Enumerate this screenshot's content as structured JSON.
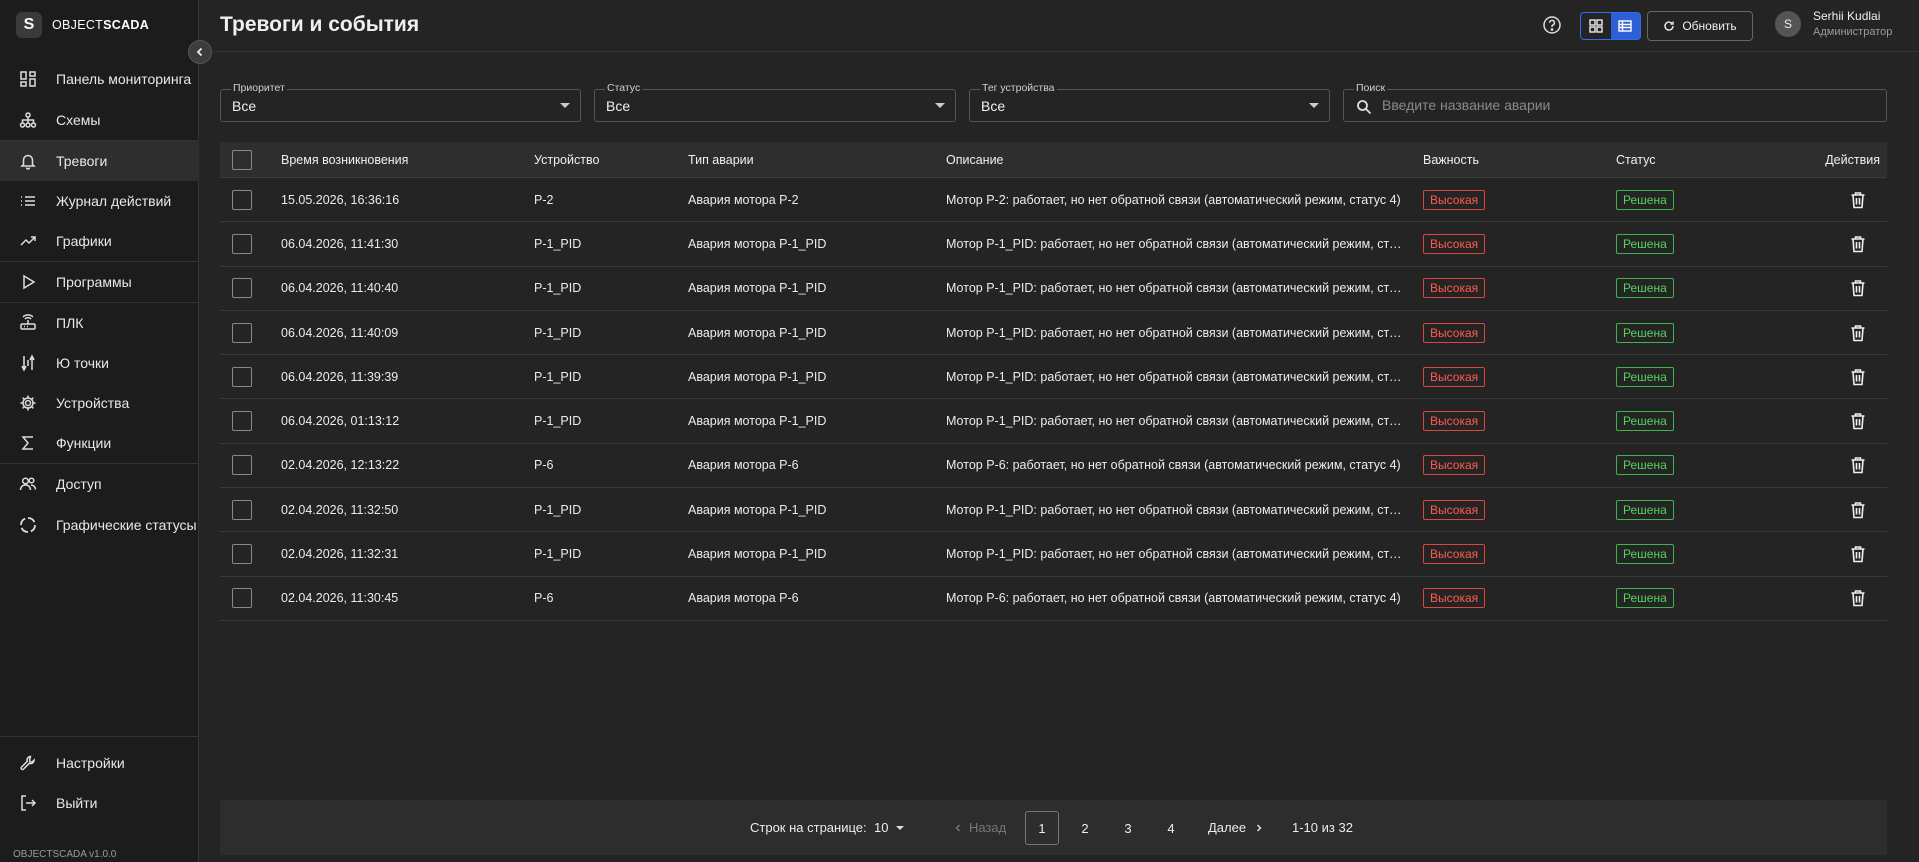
{
  "brand": {
    "mark": "S",
    "name_light": "OBJECT",
    "name_bold": "SCADA",
    "version": "OBJECTSCADA v1.0.0"
  },
  "sidebar": {
    "items": [
      {
        "label": "Панель мониторинга",
        "icon": "dashboard-icon"
      },
      {
        "label": "Схемы",
        "icon": "schema-icon"
      },
      {
        "label": "Тревоги",
        "icon": "bell-icon"
      },
      {
        "label": "Журнал действий",
        "icon": "list-icon"
      },
      {
        "label": "Графики",
        "icon": "trend-icon"
      },
      {
        "label": "Программы",
        "icon": "play-icon"
      },
      {
        "label": "ПЛК",
        "icon": "router-icon"
      },
      {
        "label": "Ю точки",
        "icon": "io-icon"
      },
      {
        "label": "Устройства",
        "icon": "gear-icon"
      },
      {
        "label": "Функции",
        "icon": "sigma-icon"
      },
      {
        "label": "Доступ",
        "icon": "users-icon"
      },
      {
        "label": "Графические статусы",
        "icon": "circle-status-icon"
      }
    ],
    "bottom": [
      {
        "label": "Настройки",
        "icon": "wrench-icon"
      },
      {
        "label": "Выйти",
        "icon": "logout-icon"
      }
    ]
  },
  "header": {
    "title": "Тревоги и события",
    "refresh_label": "Обновить",
    "user_initial": "S",
    "user_name": "Serhii Kudlai",
    "user_role": "Администратор"
  },
  "filters": {
    "priority": {
      "label": "Приоритет",
      "value": "Все"
    },
    "status": {
      "label": "Статус",
      "value": "Все"
    },
    "device_tag": {
      "label": "Тег устройства",
      "value": "Все"
    },
    "search": {
      "label": "Поиск",
      "placeholder": "Введите название аварии"
    }
  },
  "table": {
    "columns": {
      "time": "Время возникновения",
      "device": "Устройство",
      "type": "Тип аварии",
      "description": "Описание",
      "importance": "Важность",
      "status": "Статус",
      "actions": "Действия"
    },
    "rows": [
      {
        "time": "15.05.2026, 16:36:16",
        "device": "P-2",
        "type": "Авария мотора P-2",
        "description": "Мотор P-2: работает, но нет обратной связи (автоматический режим, статус 4)",
        "importance": "Высокая",
        "status": "Решена"
      },
      {
        "time": "06.04.2026, 11:41:30",
        "device": "P-1_PID",
        "type": "Авария мотора P-1_PID",
        "description": "Мотор P-1_PID: работает, но нет обратной связи (автоматический режим, ста...",
        "importance": "Высокая",
        "status": "Решена"
      },
      {
        "time": "06.04.2026, 11:40:40",
        "device": "P-1_PID",
        "type": "Авария мотора P-1_PID",
        "description": "Мотор P-1_PID: работает, но нет обратной связи (автоматический режим, ста...",
        "importance": "Высокая",
        "status": "Решена"
      },
      {
        "time": "06.04.2026, 11:40:09",
        "device": "P-1_PID",
        "type": "Авария мотора P-1_PID",
        "description": "Мотор P-1_PID: работает, но нет обратной связи (автоматический режим, ста...",
        "importance": "Высокая",
        "status": "Решена"
      },
      {
        "time": "06.04.2026, 11:39:39",
        "device": "P-1_PID",
        "type": "Авария мотора P-1_PID",
        "description": "Мотор P-1_PID: работает, но нет обратной связи (автоматический режим, ста...",
        "importance": "Высокая",
        "status": "Решена"
      },
      {
        "time": "06.04.2026, 01:13:12",
        "device": "P-1_PID",
        "type": "Авария мотора P-1_PID",
        "description": "Мотор P-1_PID: работает, но нет обратной связи (автоматический режим, ста...",
        "importance": "Высокая",
        "status": "Решена"
      },
      {
        "time": "02.04.2026, 12:13:22",
        "device": "P-6",
        "type": "Авария мотора P-6",
        "description": "Мотор P-6: работает, но нет обратной связи (автоматический режим, статус 4)",
        "importance": "Высокая",
        "status": "Решена"
      },
      {
        "time": "02.04.2026, 11:32:50",
        "device": "P-1_PID",
        "type": "Авария мотора P-1_PID",
        "description": "Мотор P-1_PID: работает, но нет обратной связи (автоматический режим, ста...",
        "importance": "Высокая",
        "status": "Решена"
      },
      {
        "time": "02.04.2026, 11:32:31",
        "device": "P-1_PID",
        "type": "Авария мотора P-1_PID",
        "description": "Мотор P-1_PID: работает, но нет обратной связи (автоматический режим, ста...",
        "importance": "Высокая",
        "status": "Решена"
      },
      {
        "time": "02.04.2026, 11:30:45",
        "device": "P-6",
        "type": "Авария мотора P-6",
        "description": "Мотор P-6: работает, но нет обратной связи (автоматический режим, статус 4)",
        "importance": "Высокая",
        "status": "Решена"
      }
    ]
  },
  "pagination": {
    "rows_per_page_label": "Строк на странице:",
    "rows_per_page": "10",
    "prev_label": "Назад",
    "next_label": "Далее",
    "pages": [
      "1",
      "2",
      "3",
      "4"
    ],
    "current_page": "1",
    "range": "1-10 из 32"
  },
  "colors": {
    "accent": "#2f6df0",
    "danger": "#ff5a50",
    "success": "#52d35d"
  }
}
